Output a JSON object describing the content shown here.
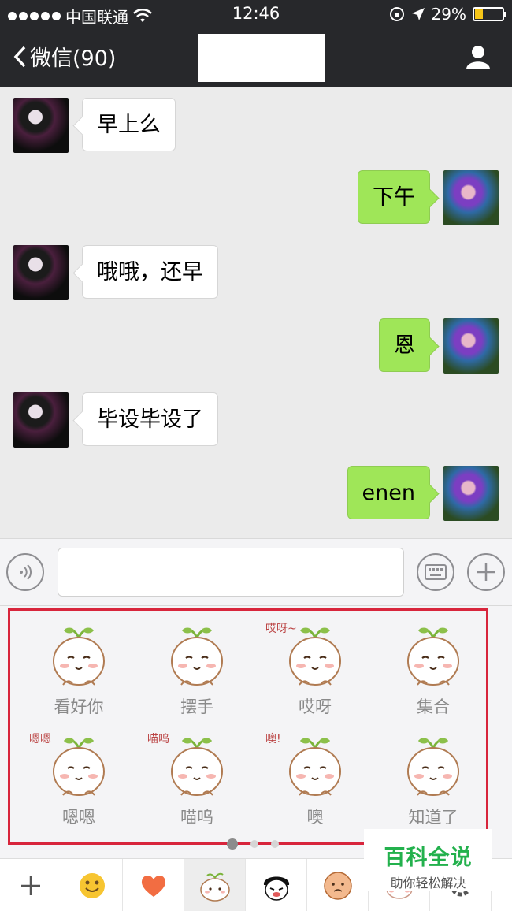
{
  "status": {
    "carrier": "中国联通",
    "time": "12:46",
    "battery_text": "29%",
    "battery_level": 0.29
  },
  "nav": {
    "back_label": "微信(90)"
  },
  "messages": [
    {
      "side": "in",
      "text": "早上么"
    },
    {
      "side": "out",
      "text": "下午"
    },
    {
      "side": "in",
      "text": "哦哦，还早"
    },
    {
      "side": "out",
      "text": "恩"
    },
    {
      "side": "in",
      "text": "毕设毕设了"
    },
    {
      "side": "out",
      "text": "enen"
    }
  ],
  "input": {
    "value": ""
  },
  "stickers": [
    {
      "label": "看好你",
      "deco": ""
    },
    {
      "label": "摆手",
      "deco": ""
    },
    {
      "label": "哎呀",
      "deco": "哎呀~"
    },
    {
      "label": "集合",
      "deco": ""
    },
    {
      "label": "嗯嗯",
      "deco": "嗯嗯"
    },
    {
      "label": "喵呜",
      "deco": "喵呜"
    },
    {
      "label": "噢",
      "deco": "噢!"
    },
    {
      "label": "知道了",
      "deco": ""
    }
  ],
  "pager": {
    "pages": 3,
    "current": 1
  },
  "tabs": [
    {
      "icon": "plus-icon"
    },
    {
      "icon": "smiley-icon"
    },
    {
      "icon": "heart-icon"
    },
    {
      "icon": "sprout-sticker-icon"
    },
    {
      "icon": "panda-sticker-icon"
    },
    {
      "icon": "bun-sticker-icon"
    },
    {
      "icon": "sticker-pack-icon"
    },
    {
      "icon": "gear-icon"
    }
  ],
  "watermark": {
    "title": "百科全说",
    "subtitle": "助你轻松解决"
  },
  "colors": {
    "nav_bg": "#27282b",
    "bubble_out": "#9fe658",
    "highlight": "#d8253c",
    "watermark_green": "#23b14d"
  }
}
